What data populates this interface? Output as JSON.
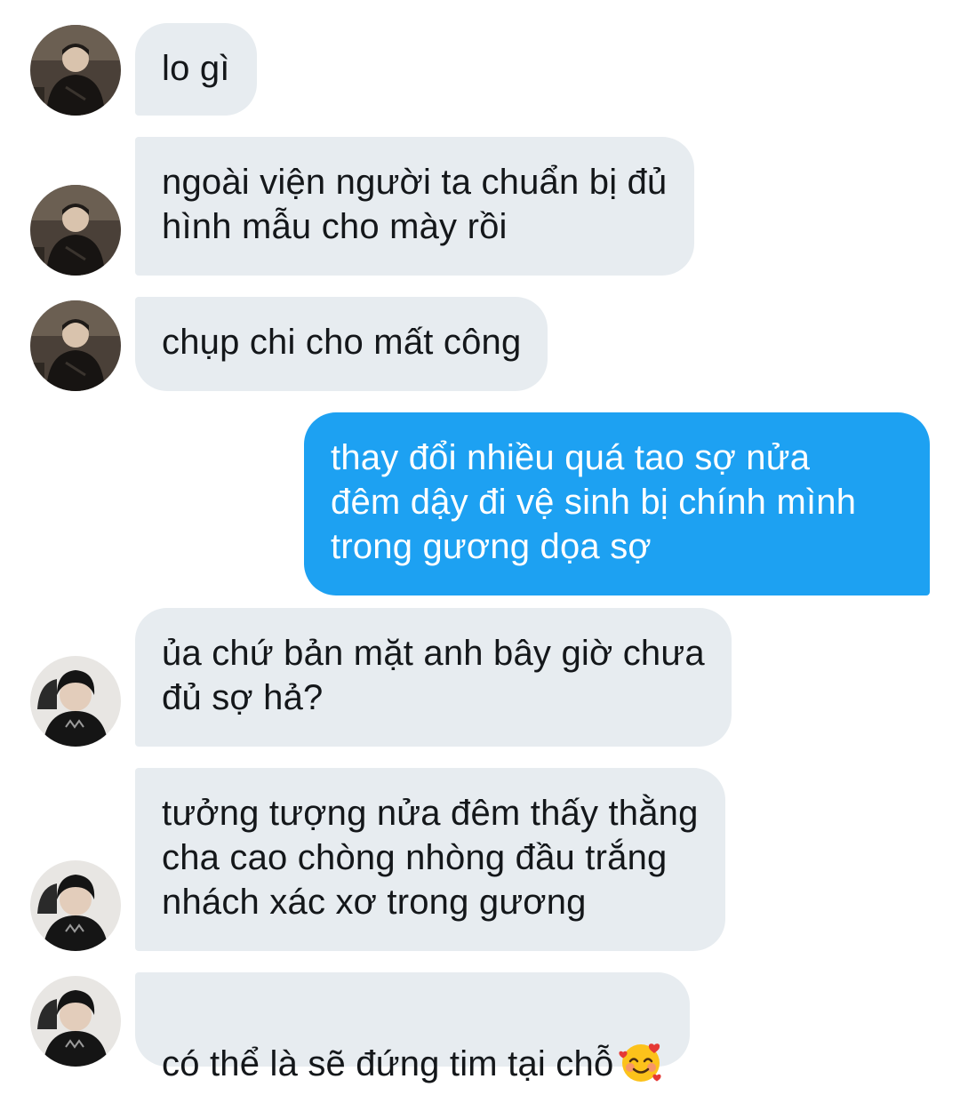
{
  "conversation": {
    "messages": [
      {
        "direction": "incoming",
        "text": "lo gì",
        "avatar": "avatar-1"
      },
      {
        "direction": "incoming",
        "text": "ngoài viện người ta chuẩn bị đủ\nhình mẫu cho mày rồi",
        "avatar": "avatar-1"
      },
      {
        "direction": "incoming",
        "text": "chụp chi cho mất công",
        "avatar": "avatar-1"
      },
      {
        "direction": "outgoing",
        "text": "thay đổi nhiều quá tao sợ nửa\nđêm dậy đi vệ sinh bị chính mình\ntrong gương dọa sợ"
      },
      {
        "direction": "incoming",
        "text": "ủa chứ bản mặt anh bây giờ chưa\nđủ sợ hả?",
        "avatar": "avatar-2"
      },
      {
        "direction": "incoming",
        "text": "tưởng tượng nửa đêm thấy thằng\ncha cao chòng nhòng đầu trắng\nnhách xác xơ trong gương",
        "avatar": "avatar-2"
      },
      {
        "direction": "incoming",
        "text": "có thể là sẽ đứng tim tại chỗ",
        "avatar": "avatar-2",
        "emoji": "smiling-face-with-hearts-icon"
      }
    ]
  },
  "colors": {
    "incoming_bubble": "#e7ecf0",
    "outgoing_bubble": "#1da1f2",
    "incoming_text": "#14171a",
    "outgoing_text": "#ffffff"
  }
}
